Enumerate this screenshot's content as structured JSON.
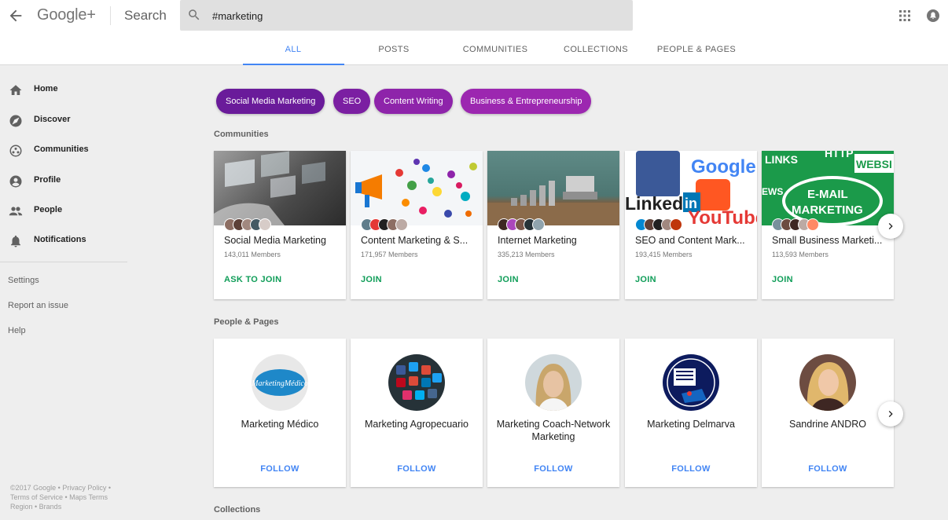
{
  "header": {
    "logo": "Google+",
    "section": "Search",
    "search_value": "#marketing"
  },
  "tabs": [
    {
      "label": "ALL",
      "active": true
    },
    {
      "label": "POSTS"
    },
    {
      "label": "COMMUNITIES"
    },
    {
      "label": "COLLECTIONS"
    },
    {
      "label": "PEOPLE & PAGES"
    }
  ],
  "sidebar": {
    "items": [
      {
        "label": "Home",
        "icon": "home-icon"
      },
      {
        "label": "Discover",
        "icon": "compass-icon"
      },
      {
        "label": "Communities",
        "icon": "communities-icon"
      },
      {
        "label": "Profile",
        "icon": "profile-icon"
      },
      {
        "label": "People",
        "icon": "people-icon"
      },
      {
        "label": "Notifications",
        "icon": "bell-icon"
      }
    ],
    "links": [
      "Settings",
      "Report an issue",
      "Help"
    ],
    "footer": "©2017 Google • Privacy Policy • Terms of Service • Maps Terms Region • Brands"
  },
  "chips": [
    {
      "label": "Social Media Marketing",
      "color": "#6a1b9a"
    },
    {
      "label": "SEO",
      "color": "#7b1fa2"
    },
    {
      "label": "Content Writing",
      "color": "#8e24aa"
    },
    {
      "label": "Business & Entrepreneurship",
      "color": "#9c27b0"
    }
  ],
  "communities": {
    "title": "Communities",
    "items": [
      {
        "name": "Social Media Marketing",
        "members": "143,011 Members",
        "action": "ASK TO JOIN"
      },
      {
        "name": "Content Marketing & S...",
        "members": "171,957 Members",
        "action": "JOIN"
      },
      {
        "name": "Internet Marketing",
        "members": "335,213 Members",
        "action": "JOIN"
      },
      {
        "name": "SEO and Content Mark...",
        "members": "193,415 Members",
        "action": "JOIN"
      },
      {
        "name": "Small Business Marketi...",
        "members": "113,593 Members",
        "action": "JOIN"
      }
    ],
    "image_texts": {
      "c4_a": "Google",
      "c4_b": "Linked",
      "c4_c": "in",
      "c4_d": "YouTube",
      "c5_a": "LINKS",
      "c5_b": "HTTP",
      "c5_c": "WEBSI",
      "c5_d": "EWS",
      "c5_e": "E-MAIL",
      "c5_f": "MARKETING"
    }
  },
  "people": {
    "title": "People & Pages",
    "items": [
      {
        "name": "Marketing Médico",
        "action": "FOLLOW",
        "avatar_text": "MarketingMédico"
      },
      {
        "name": "Marketing Agropecuario",
        "action": "FOLLOW"
      },
      {
        "name": "Marketing Coach-Network Marketing",
        "action": "FOLLOW"
      },
      {
        "name": "Marketing Delmarva",
        "action": "FOLLOW"
      },
      {
        "name": "Sandrine ANDRO",
        "action": "FOLLOW"
      }
    ]
  },
  "collections": {
    "title": "Collections"
  }
}
